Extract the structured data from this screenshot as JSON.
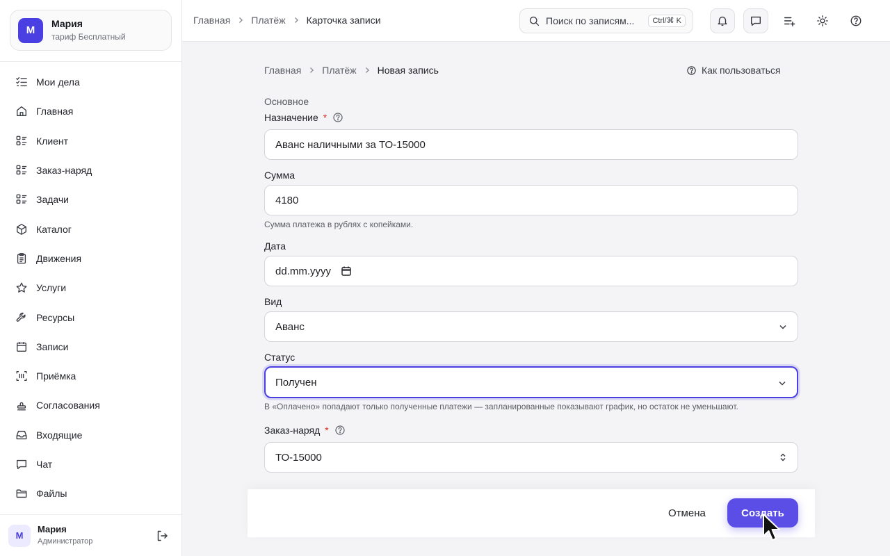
{
  "account": {
    "avatar_letter": "М",
    "name": "Мария",
    "plan": "тариф Бесплатный"
  },
  "sidebar": {
    "items": [
      {
        "label": "Мои дела",
        "icon": "checklist-icon"
      },
      {
        "label": "Главная",
        "icon": "home-icon"
      },
      {
        "label": "Клиент",
        "icon": "list-grid-icon"
      },
      {
        "label": "Заказ-наряд",
        "icon": "list-grid-icon"
      },
      {
        "label": "Задачи",
        "icon": "list-grid-icon"
      },
      {
        "label": "Каталог",
        "icon": "box-icon"
      },
      {
        "label": "Движения",
        "icon": "clipboard-icon"
      },
      {
        "label": "Услуги",
        "icon": "star-icon"
      },
      {
        "label": "Ресурсы",
        "icon": "wrench-icon"
      },
      {
        "label": "Записи",
        "icon": "calendar-icon"
      },
      {
        "label": "Приёмка",
        "icon": "barcode-scan-icon"
      },
      {
        "label": "Согласования",
        "icon": "stamp-icon"
      },
      {
        "label": "Входящие",
        "icon": "inbox-icon"
      },
      {
        "label": "Чат",
        "icon": "chat-icon"
      },
      {
        "label": "Файлы",
        "icon": "folder-icon"
      }
    ]
  },
  "user": {
    "avatar_letter": "М",
    "name": "Мария",
    "role": "Администратор"
  },
  "topbar": {
    "breadcrumbs": [
      "Главная",
      "Платёж",
      "Карточка записи"
    ],
    "search": {
      "placeholder": "Поиск по записям...",
      "shortcut": "Ctrl/⌘ K"
    }
  },
  "page": {
    "breadcrumbs": [
      "Главная",
      "Платёж",
      "Новая запись"
    ],
    "help_label": "Как пользоваться",
    "section_title": "Основное"
  },
  "form": {
    "purpose": {
      "label": "Назначение",
      "required_mark": "*",
      "value": "Аванс наличными за ТО-15000"
    },
    "amount": {
      "label": "Сумма",
      "value": "4180",
      "hint": "Сумма платежа в рублях с копейками."
    },
    "date": {
      "label": "Дата",
      "placeholder": "dd.mm.yyyy"
    },
    "kind": {
      "label": "Вид",
      "value": "Аванс"
    },
    "status": {
      "label": "Статус",
      "value": "Получен",
      "hint": "В «Оплачено» попадают только полученные платежи — запланированные показывают график, но остаток не уменьшают."
    },
    "order": {
      "label": "Заказ-наряд",
      "required_mark": "*",
      "value": "ТО-15000"
    }
  },
  "actions": {
    "cancel_label": "Отмена",
    "create_label": "Создать"
  },
  "colors": {
    "accent": "#5b4ee6",
    "required": "#d92d20"
  }
}
